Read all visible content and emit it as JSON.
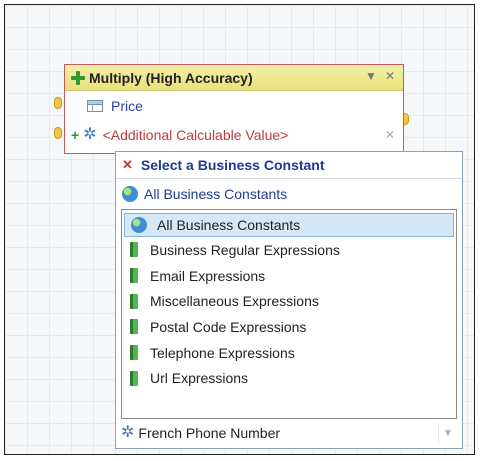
{
  "node": {
    "title": "Multiply (High Accuracy)",
    "rows": [
      {
        "label": "Price"
      },
      {
        "label": "<Additional Calculable Value>"
      }
    ]
  },
  "panel": {
    "title": "Select a Business Constant",
    "selected": "All Business Constants",
    "items": [
      "All Business Constants",
      "Business Regular Expressions",
      "Email Expressions",
      "Miscellaneous Expressions",
      "Postal Code Expressions",
      "Telephone Expressions",
      "Url Expressions"
    ],
    "footer_value": "French Phone Number"
  },
  "colors": {
    "node_border": "#c8595b",
    "header_fill": "#eee693",
    "link_blue": "#1f3a93",
    "alert_red": "#c0393b",
    "selection": "#d5e8f7"
  },
  "icons": [
    "plus-icon",
    "dropdown-arrow-icon",
    "close-icon",
    "table-icon",
    "gear-icon",
    "globe-icon",
    "book-icon"
  ]
}
